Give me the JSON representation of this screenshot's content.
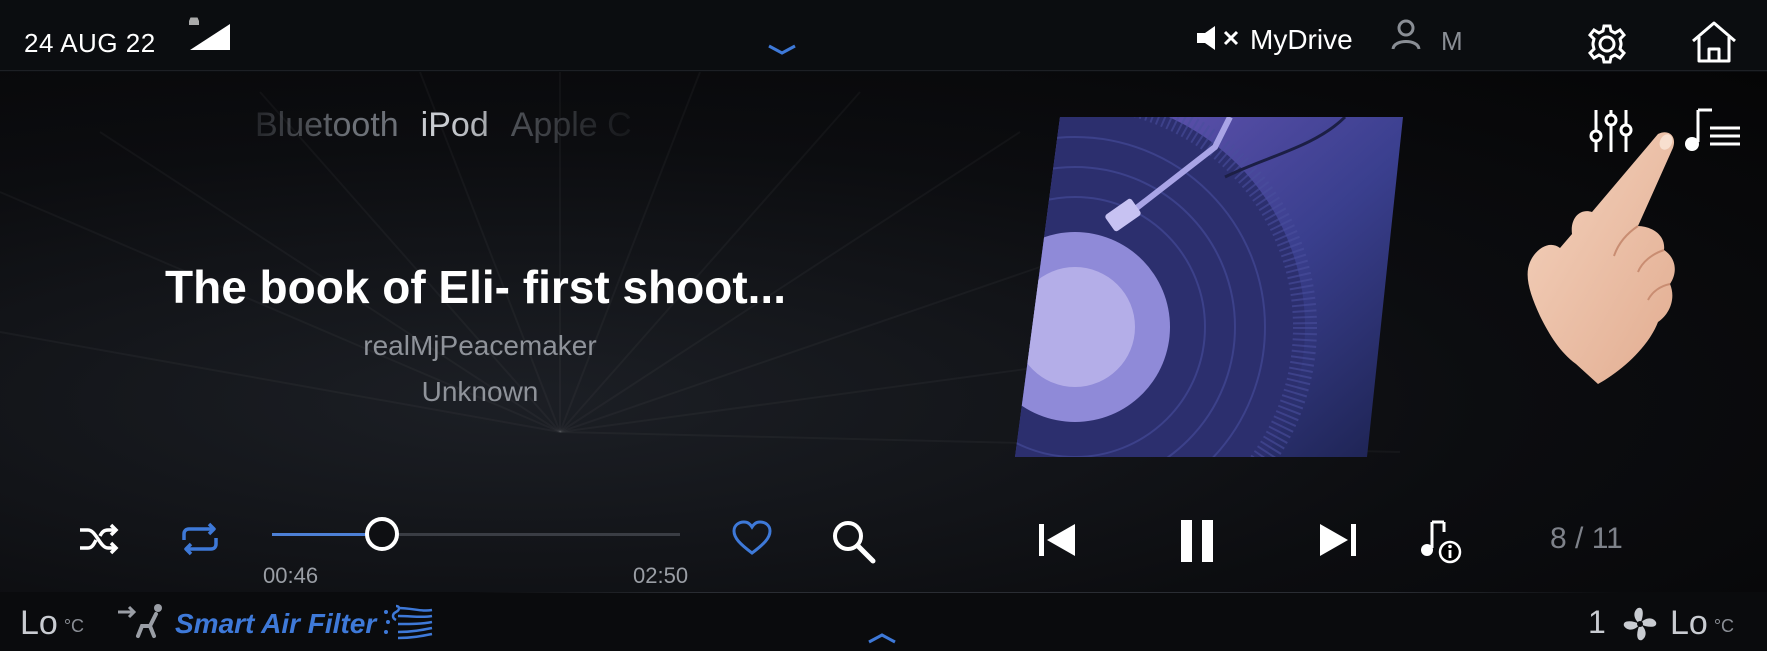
{
  "status_bar": {
    "date": "24 AUG 22",
    "audio_label": "MyDrive",
    "profile_letter": "M"
  },
  "sources": [
    {
      "label": "Bluetooth",
      "active": false
    },
    {
      "label": "iPod",
      "active": true
    },
    {
      "label": "Apple C",
      "active": false
    }
  ],
  "now_playing": {
    "title": "The book of Eli- first shoot...",
    "artist": "realMjPeacemaker",
    "album": "Unknown",
    "time_current": "00:46",
    "time_total": "02:50",
    "progress": 0.27,
    "track_position": "8 / 11"
  },
  "icons": {
    "top": [
      "car-icon",
      "signal-icon",
      "collapse-handle-icon",
      "mute-icon",
      "profile-icon",
      "gear-icon",
      "home-icon"
    ],
    "media": [
      "equalizer-icon",
      "playlist-icon",
      "shuffle-icon",
      "repeat-icon",
      "heart-icon",
      "search-icon",
      "previous-icon",
      "pause-icon",
      "next-icon",
      "track-info-icon"
    ],
    "climate": [
      "seat-air-icon",
      "air-filter-icon",
      "fan-icon"
    ]
  },
  "climate": {
    "left_temp": "Lo",
    "left_unit": "°C",
    "smart_filter_label": "Smart Air Filter",
    "fan_level": "1",
    "right_temp": "Lo",
    "right_unit": "°C"
  },
  "colors": {
    "accent": "#3e79d8",
    "background": "#000000",
    "text_primary": "#ffffff",
    "text_secondary": "#8f939a"
  }
}
